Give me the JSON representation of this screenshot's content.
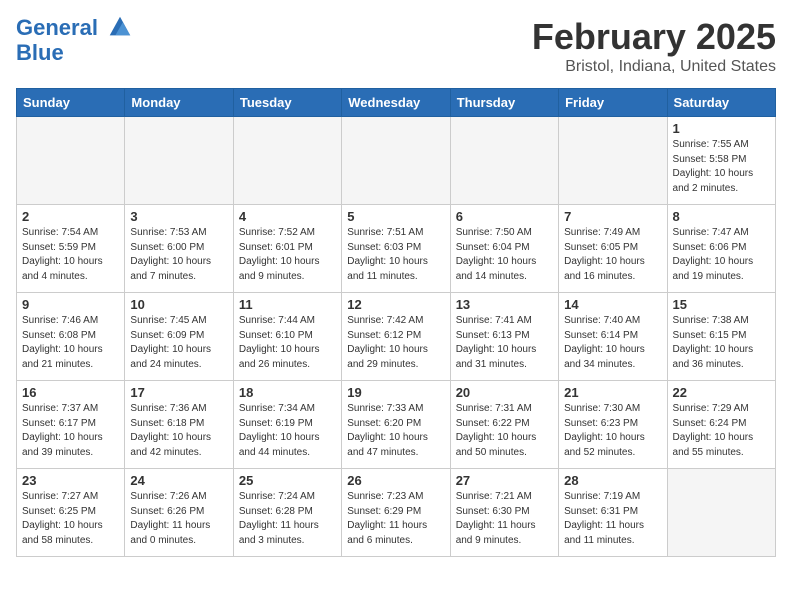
{
  "header": {
    "logo_line1": "General",
    "logo_line2": "Blue",
    "title": "February 2025",
    "subtitle": "Bristol, Indiana, United States"
  },
  "weekdays": [
    "Sunday",
    "Monday",
    "Tuesday",
    "Wednesday",
    "Thursday",
    "Friday",
    "Saturday"
  ],
  "weeks": [
    [
      {
        "day": "",
        "info": ""
      },
      {
        "day": "",
        "info": ""
      },
      {
        "day": "",
        "info": ""
      },
      {
        "day": "",
        "info": ""
      },
      {
        "day": "",
        "info": ""
      },
      {
        "day": "",
        "info": ""
      },
      {
        "day": "1",
        "info": "Sunrise: 7:55 AM\nSunset: 5:58 PM\nDaylight: 10 hours and 2 minutes."
      }
    ],
    [
      {
        "day": "2",
        "info": "Sunrise: 7:54 AM\nSunset: 5:59 PM\nDaylight: 10 hours and 4 minutes."
      },
      {
        "day": "3",
        "info": "Sunrise: 7:53 AM\nSunset: 6:00 PM\nDaylight: 10 hours and 7 minutes."
      },
      {
        "day": "4",
        "info": "Sunrise: 7:52 AM\nSunset: 6:01 PM\nDaylight: 10 hours and 9 minutes."
      },
      {
        "day": "5",
        "info": "Sunrise: 7:51 AM\nSunset: 6:03 PM\nDaylight: 10 hours and 11 minutes."
      },
      {
        "day": "6",
        "info": "Sunrise: 7:50 AM\nSunset: 6:04 PM\nDaylight: 10 hours and 14 minutes."
      },
      {
        "day": "7",
        "info": "Sunrise: 7:49 AM\nSunset: 6:05 PM\nDaylight: 10 hours and 16 minutes."
      },
      {
        "day": "8",
        "info": "Sunrise: 7:47 AM\nSunset: 6:06 PM\nDaylight: 10 hours and 19 minutes."
      }
    ],
    [
      {
        "day": "9",
        "info": "Sunrise: 7:46 AM\nSunset: 6:08 PM\nDaylight: 10 hours and 21 minutes."
      },
      {
        "day": "10",
        "info": "Sunrise: 7:45 AM\nSunset: 6:09 PM\nDaylight: 10 hours and 24 minutes."
      },
      {
        "day": "11",
        "info": "Sunrise: 7:44 AM\nSunset: 6:10 PM\nDaylight: 10 hours and 26 minutes."
      },
      {
        "day": "12",
        "info": "Sunrise: 7:42 AM\nSunset: 6:12 PM\nDaylight: 10 hours and 29 minutes."
      },
      {
        "day": "13",
        "info": "Sunrise: 7:41 AM\nSunset: 6:13 PM\nDaylight: 10 hours and 31 minutes."
      },
      {
        "day": "14",
        "info": "Sunrise: 7:40 AM\nSunset: 6:14 PM\nDaylight: 10 hours and 34 minutes."
      },
      {
        "day": "15",
        "info": "Sunrise: 7:38 AM\nSunset: 6:15 PM\nDaylight: 10 hours and 36 minutes."
      }
    ],
    [
      {
        "day": "16",
        "info": "Sunrise: 7:37 AM\nSunset: 6:17 PM\nDaylight: 10 hours and 39 minutes."
      },
      {
        "day": "17",
        "info": "Sunrise: 7:36 AM\nSunset: 6:18 PM\nDaylight: 10 hours and 42 minutes."
      },
      {
        "day": "18",
        "info": "Sunrise: 7:34 AM\nSunset: 6:19 PM\nDaylight: 10 hours and 44 minutes."
      },
      {
        "day": "19",
        "info": "Sunrise: 7:33 AM\nSunset: 6:20 PM\nDaylight: 10 hours and 47 minutes."
      },
      {
        "day": "20",
        "info": "Sunrise: 7:31 AM\nSunset: 6:22 PM\nDaylight: 10 hours and 50 minutes."
      },
      {
        "day": "21",
        "info": "Sunrise: 7:30 AM\nSunset: 6:23 PM\nDaylight: 10 hours and 52 minutes."
      },
      {
        "day": "22",
        "info": "Sunrise: 7:29 AM\nSunset: 6:24 PM\nDaylight: 10 hours and 55 minutes."
      }
    ],
    [
      {
        "day": "23",
        "info": "Sunrise: 7:27 AM\nSunset: 6:25 PM\nDaylight: 10 hours and 58 minutes."
      },
      {
        "day": "24",
        "info": "Sunrise: 7:26 AM\nSunset: 6:26 PM\nDaylight: 11 hours and 0 minutes."
      },
      {
        "day": "25",
        "info": "Sunrise: 7:24 AM\nSunset: 6:28 PM\nDaylight: 11 hours and 3 minutes."
      },
      {
        "day": "26",
        "info": "Sunrise: 7:23 AM\nSunset: 6:29 PM\nDaylight: 11 hours and 6 minutes."
      },
      {
        "day": "27",
        "info": "Sunrise: 7:21 AM\nSunset: 6:30 PM\nDaylight: 11 hours and 9 minutes."
      },
      {
        "day": "28",
        "info": "Sunrise: 7:19 AM\nSunset: 6:31 PM\nDaylight: 11 hours and 11 minutes."
      },
      {
        "day": "",
        "info": ""
      }
    ]
  ]
}
